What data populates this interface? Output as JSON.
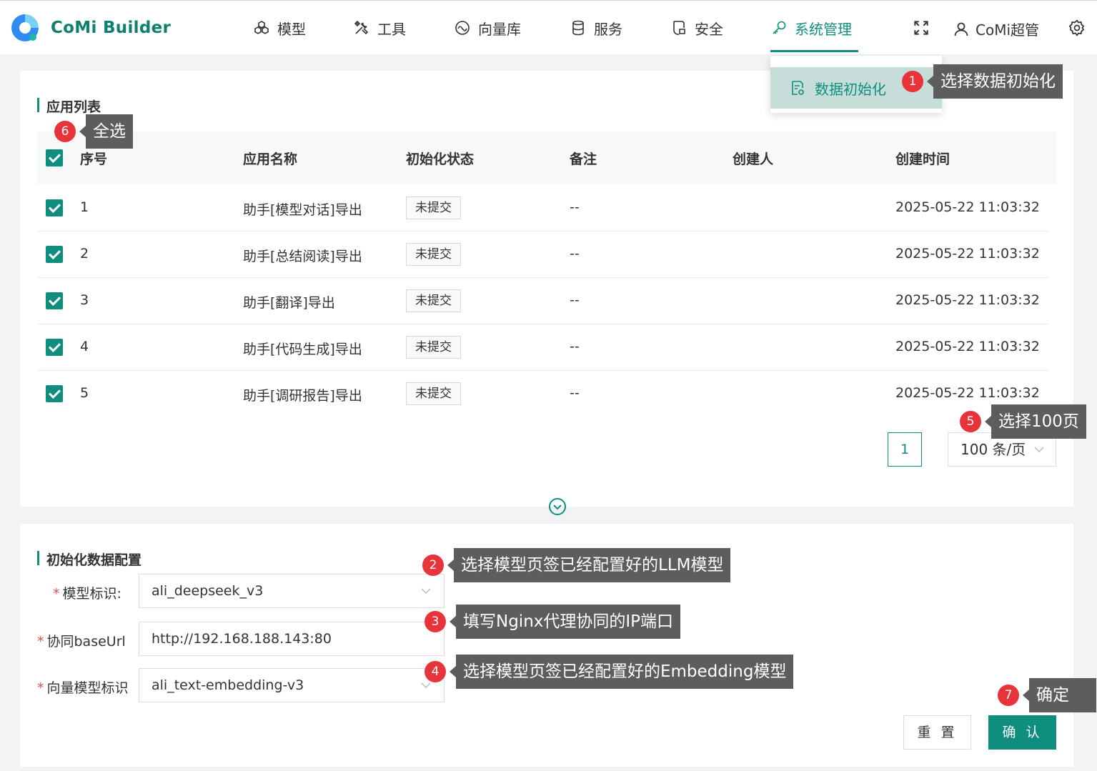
{
  "header": {
    "brand": "CoMi Builder",
    "nav": [
      {
        "label": "模型",
        "icon": "cubes-icon"
      },
      {
        "label": "工具",
        "icon": "tools-icon"
      },
      {
        "label": "向量库",
        "icon": "vector-icon"
      },
      {
        "label": "服务",
        "icon": "database-icon"
      },
      {
        "label": "安全",
        "icon": "shield-icon"
      },
      {
        "label": "系统管理",
        "icon": "key-icon",
        "active": true
      }
    ],
    "user": "CoMi超管",
    "accent_color": "#0f8e80"
  },
  "dropdown": {
    "item_label": "数据初始化"
  },
  "app_list": {
    "title": "应用列表",
    "columns": [
      "序号",
      "应用名称",
      "初始化状态",
      "备注",
      "创建人",
      "创建时间"
    ],
    "rows": [
      {
        "index": "1",
        "name": "助手[模型对话]导出",
        "status": "未提交",
        "remark": "--",
        "creator": "",
        "created": "2025-05-22 11:03:32"
      },
      {
        "index": "2",
        "name": "助手[总结阅读]导出",
        "status": "未提交",
        "remark": "--",
        "creator": "",
        "created": "2025-05-22 11:03:32"
      },
      {
        "index": "3",
        "name": "助手[翻译]导出",
        "status": "未提交",
        "remark": "--",
        "creator": "",
        "created": "2025-05-22 11:03:32"
      },
      {
        "index": "4",
        "name": "助手[代码生成]导出",
        "status": "未提交",
        "remark": "--",
        "creator": "",
        "created": "2025-05-22 11:03:32"
      },
      {
        "index": "5",
        "name": "助手[调研报告]导出",
        "status": "未提交",
        "remark": "--",
        "creator": "",
        "created": "2025-05-22 11:03:32"
      }
    ],
    "pagination": {
      "current_page": "1",
      "page_size": "100 条/页"
    }
  },
  "config": {
    "title": "初始化数据配置",
    "fields": [
      {
        "label": "模型标识:",
        "value": "ali_deepseek_v3"
      },
      {
        "label": "协同baseUrl",
        "value": "http://192.168.188.143:80"
      },
      {
        "label": "向量模型标识",
        "value": "ali_text-embedding-v3"
      }
    ],
    "reset_label": "重 置",
    "confirm_label": "确 认"
  },
  "annotations": [
    {
      "num": "1",
      "text": "选择数据初始化"
    },
    {
      "num": "2",
      "text": "选择模型页签已经配置好的LLM模型"
    },
    {
      "num": "3",
      "text": "填写Nginx代理协同的IP端口"
    },
    {
      "num": "4",
      "text": "选择模型页签已经配置好的Embedding模型"
    },
    {
      "num": "5",
      "text": "选择100页"
    },
    {
      "num": "6",
      "text": "全选"
    },
    {
      "num": "7",
      "text": "确定"
    }
  ]
}
